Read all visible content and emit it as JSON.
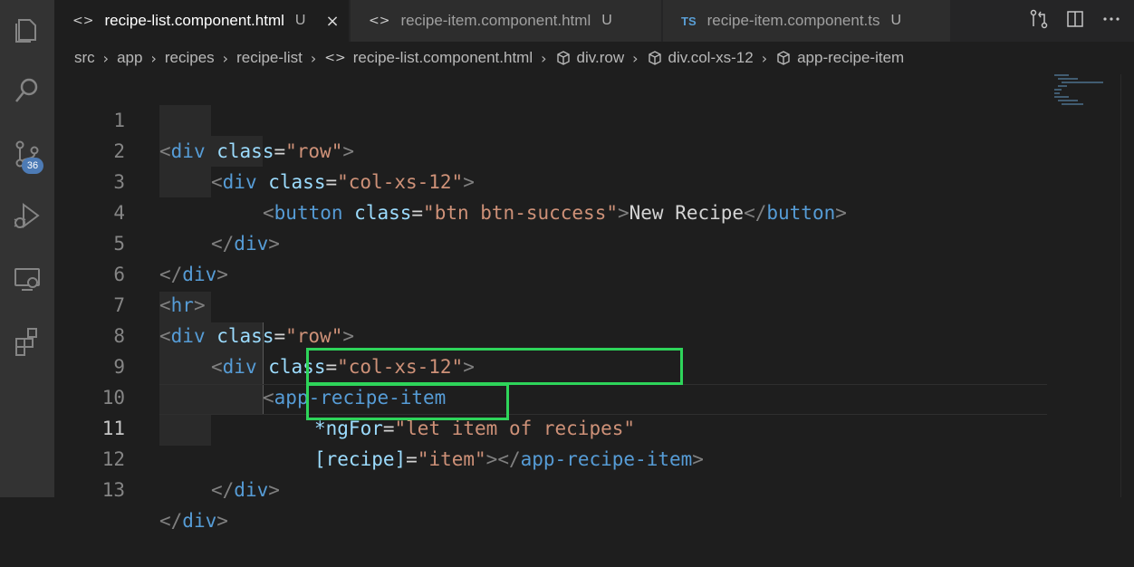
{
  "tabs": [
    {
      "label": "recipe-list.component.html",
      "icon": "html-file-icon",
      "icon_glyph": "<>",
      "status": "U",
      "close": "×",
      "active": true
    },
    {
      "label": "recipe-item.component.html",
      "icon": "html-file-icon",
      "icon_glyph": "<>",
      "status": "U",
      "active": false
    },
    {
      "label": "recipe-item.component.ts",
      "icon": "ts-file-icon",
      "icon_glyph": "TS",
      "status": "U",
      "active": false
    }
  ],
  "breadcrumb": {
    "segments": [
      "src",
      "app",
      "recipes",
      "recipe-list"
    ],
    "file": "recipe-list.component.html",
    "file_glyph": "<>",
    "symbols": [
      "div.row",
      "div.col-xs-12",
      "app-recipe-item"
    ]
  },
  "activity_bar": {
    "scm_badge": "36",
    "icons": [
      "explorer-icon",
      "search-icon",
      "source-control-icon",
      "run-debug-icon",
      "remote-explorer-icon",
      "extensions-icon"
    ]
  },
  "editor": {
    "current_line": 11,
    "lines": [
      {
        "n": "1"
      },
      {
        "n": "2"
      },
      {
        "n": "3"
      },
      {
        "n": "4"
      },
      {
        "n": "5"
      },
      {
        "n": "6"
      },
      {
        "n": "7"
      },
      {
        "n": "8"
      },
      {
        "n": "9"
      },
      {
        "n": "10"
      },
      {
        "n": "11"
      },
      {
        "n": "12"
      },
      {
        "n": "13"
      }
    ],
    "tokens": {
      "l1": [
        "<",
        "div",
        " ",
        "class",
        "=",
        "\"row\"",
        ">"
      ],
      "l2": [
        "<",
        "div",
        " ",
        "class",
        "=",
        "\"col-xs-12\"",
        ">"
      ],
      "l3": [
        "<",
        "button",
        " ",
        "class",
        "=",
        "\"btn btn-success\"",
        ">",
        "New Recipe",
        "</",
        "button",
        ">"
      ],
      "l4": [
        "</",
        "div",
        ">"
      ],
      "l5": [
        "</",
        "div",
        ">"
      ],
      "l6": [
        "<",
        "hr",
        ">"
      ],
      "l7": [
        "<",
        "div",
        " ",
        "class",
        "=",
        "\"row\"",
        ">"
      ],
      "l8": [
        "<",
        "div",
        " ",
        "class",
        "=",
        "\"col-xs-12\"",
        ">"
      ],
      "l9": [
        "<",
        "app-recipe-item"
      ],
      "l10": [
        "*ngFor",
        "=",
        "\"let item of recipes\""
      ],
      "l11": [
        "[recipe]",
        "=",
        "\"item\"",
        ">",
        "</",
        "app-recipe-item",
        ">"
      ],
      "l12": [
        "</",
        "div",
        ">"
      ],
      "l13": [
        "</",
        "div",
        ">"
      ]
    }
  },
  "colors": {
    "tag": "#569cd6",
    "attribute": "#9cdcfe",
    "string": "#ce9178",
    "text": "#d4d4d4",
    "punctuation": "#808080",
    "highlight_box": "#2ed45a",
    "badge": "#4d7bb5"
  }
}
